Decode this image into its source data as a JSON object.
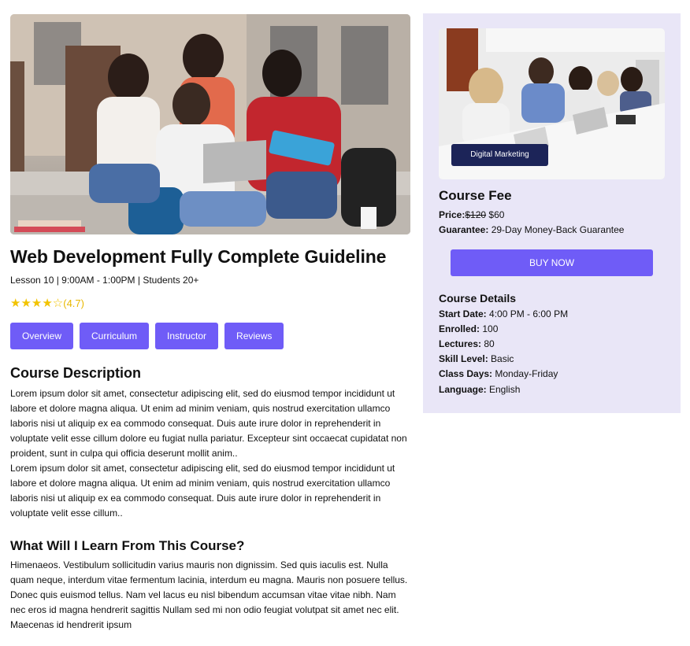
{
  "hero_image": {
    "alt": "Students with laptop"
  },
  "course": {
    "title": "Web Development Fully Complete Guideline",
    "meta": "Lesson 10 | 9:00AM - 1:00PM | Students 20+",
    "stars": "★★★★☆",
    "rating": "(4.7)",
    "rating_value": 4.7
  },
  "tabs": [
    {
      "label": "Overview"
    },
    {
      "label": "Curriculum"
    },
    {
      "label": "Instructor"
    },
    {
      "label": "Reviews"
    }
  ],
  "description": {
    "heading": "Course Description",
    "p1": "Lorem ipsum dolor sit amet, consectetur adipiscing elit, sed do eiusmod tempor incididunt ut labore et dolore magna aliqua. Ut enim ad minim veniam, quis nostrud exercitation ullamco laboris nisi ut aliquip ex ea commodo consequat. Duis aute irure dolor in reprehenderit in voluptate velit esse cillum dolore eu fugiat nulla pariatur. Excepteur sint occaecat cupidatat non proident, sunt in culpa qui officia deserunt mollit anim..",
    "p2": "Lorem ipsum dolor sit amet, consectetur adipiscing elit, sed do eiusmod tempor incididunt ut labore et dolore magna aliqua. Ut enim ad minim veniam, quis nostrud exercitation ullamco laboris nisi ut aliquip ex ea commodo consequat. Duis aute irure dolor in reprehenderit in voluptate velit esse cillum.."
  },
  "learn": {
    "heading": "What Will I Learn From This Course?",
    "text": "Himenaeos. Vestibulum sollicitudin varius mauris non dignissim. Sed quis iaculis est. Nulla quam neque, interdum vitae fermentum lacinia, interdum eu magna. Mauris non posuere tellus. Donec quis euismod tellus. Nam vel lacus eu nisl bibendum accumsan vitae vitae nibh. Nam nec eros id magna hendrerit sagittis Nullam sed mi non odio feugiat volutpat sit amet nec elit. Maecenas id hendrerit ipsum"
  },
  "sidebar": {
    "badge": "Digital Marketing",
    "fee_title": "Course Fee",
    "price_label": "Price:",
    "old_price": "$120",
    "new_price": " $60",
    "guarantee_label": "Guarantee:",
    "guarantee_value": " 29-Day Money-Back Guarantee",
    "buy_label": "BUY NOW",
    "details_title": "Course Details",
    "details": [
      {
        "label": "Start Date:",
        "value": " 4:00 PM - 6:00 PM"
      },
      {
        "label": "Enrolled:",
        "value": " 100"
      },
      {
        "label": "Lectures:",
        "value": " 80"
      },
      {
        "label": "Skill Level:",
        "value": " Basic"
      },
      {
        "label": "Class Days:",
        "value": " Monday-Friday"
      },
      {
        "label": "Language:",
        "value": " English"
      }
    ]
  },
  "colors": {
    "accent": "#6f5cf7",
    "sidebar_bg": "#e9e6f7",
    "badge_bg": "#1c2458",
    "star": "#f2c300"
  }
}
